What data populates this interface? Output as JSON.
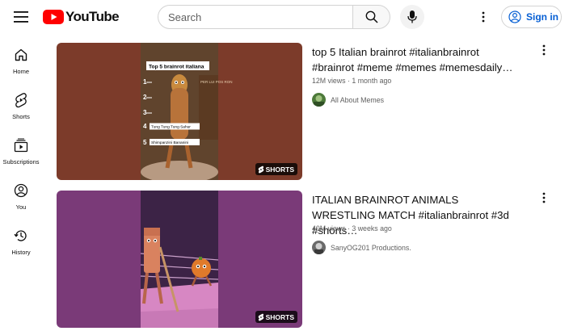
{
  "header": {
    "logo_text": "YouTube",
    "search_placeholder": "Search",
    "signin_label": "Sign in",
    "brand_red": "#ff0000",
    "accent_blue": "#065fd4"
  },
  "sidebar": {
    "items": [
      {
        "label": "Home",
        "icon": "home-icon"
      },
      {
        "label": "Shorts",
        "icon": "shorts-icon"
      },
      {
        "label": "Subscriptions",
        "icon": "subscriptions-icon"
      },
      {
        "label": "You",
        "icon": "you-icon"
      },
      {
        "label": "History",
        "icon": "history-icon"
      }
    ]
  },
  "videos": [
    {
      "title": "top 5 Italian brainrot #italianbrainrot #brainrot #meme #memes #memesdaily…",
      "meta": "12M views · 1 month ago",
      "channel": "All About Memes",
      "badge": "SHORTS",
      "thumb_text": {
        "headline": "Top 5 brainrot italiana",
        "n1": "1",
        "n2": "2",
        "n3": "3",
        "n4": "4",
        "n5": "5",
        "label4": "Tung Tung Tung Sahur",
        "label5": "Shimpanzini Bananini",
        "sign": "PER LUI POS RON"
      }
    },
    {
      "title": "ITALIAN BRAINROT ANIMALS WRESTLING MATCH #italianbrainrot #3d #shorts…",
      "meta": "40M views · 3 weeks ago",
      "channel": "SanyOG201 Productions.",
      "badge": "SHORTS"
    }
  ]
}
